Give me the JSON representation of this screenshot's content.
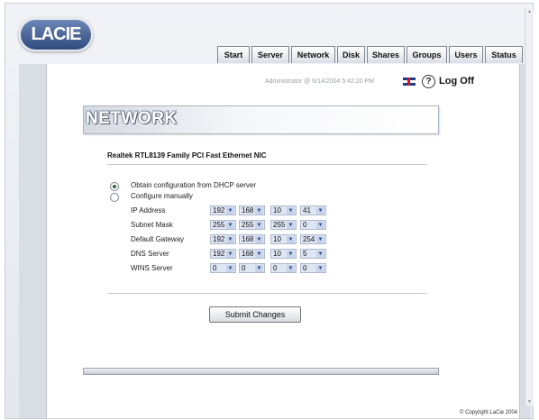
{
  "brand": {
    "logo_text": "LACIE"
  },
  "tabs": [
    {
      "label": "Start"
    },
    {
      "label": "Server"
    },
    {
      "label": "Network"
    },
    {
      "label": "Disk"
    },
    {
      "label": "Shares"
    },
    {
      "label": "Groups"
    },
    {
      "label": "Users"
    },
    {
      "label": "Status"
    }
  ],
  "header": {
    "status_text": "Administrator @ 6/14/2004 5:42:20 PM",
    "flag_icon": "uk-flag-icon",
    "help_label": "?",
    "logoff_label": "Log Off"
  },
  "page": {
    "title": "NETWORK",
    "nic_name": "Realtek RTL8139 Family PCI Fast Ethernet NIC"
  },
  "form": {
    "dhcp_label": "Obtain configuration from DHCP server",
    "manual_label": "Configure manually",
    "selected_mode": "dhcp",
    "fields": [
      {
        "label": "IP Address",
        "octets": [
          "192",
          "168",
          "10",
          "41"
        ]
      },
      {
        "label": "Subnet Mask",
        "octets": [
          "255",
          "255",
          "255",
          "0"
        ]
      },
      {
        "label": "Default Gateway",
        "octets": [
          "192",
          "168",
          "10",
          "254"
        ]
      },
      {
        "label": "DNS Server",
        "octets": [
          "192",
          "168",
          "10",
          "5"
        ]
      },
      {
        "label": "WINS Server",
        "octets": [
          "0",
          "0",
          "0",
          "0"
        ]
      }
    ],
    "submit_label": "Submit Changes"
  },
  "footer": {
    "copyright": "© Copyright LaCie 2004"
  }
}
